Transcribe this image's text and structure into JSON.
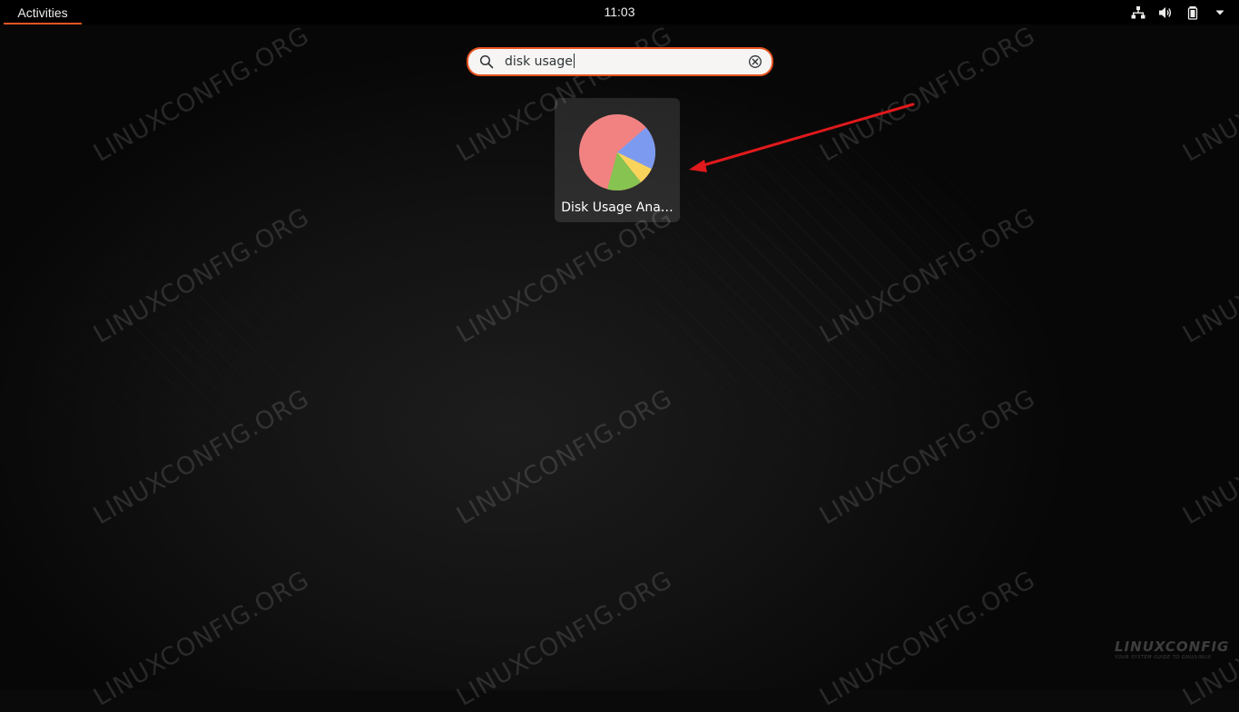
{
  "topbar": {
    "activities_label": "Activities",
    "clock": "11:03",
    "tray_icons": [
      "network-icon",
      "volume-icon",
      "battery-icon",
      "system-menu-arrow-icon"
    ]
  },
  "search": {
    "value": "disk usage"
  },
  "results": [
    {
      "label": "Disk Usage Ana…",
      "icon": "disk-usage-analyzer-icon"
    }
  ],
  "watermark": {
    "text": "LINUXCONFIG.ORG"
  },
  "brand": {
    "text": "LINUXCONFIG",
    "tagline": "YOUR SYSTEM GUIDE TO GNU/LINUX"
  },
  "colors": {
    "accent": "#e95420",
    "pie_red": "#f28282",
    "pie_blue": "#7c9bf0",
    "pie_yellow": "#f9d45c",
    "pie_green": "#87c350",
    "annotation_arrow": "#e0191c"
  }
}
